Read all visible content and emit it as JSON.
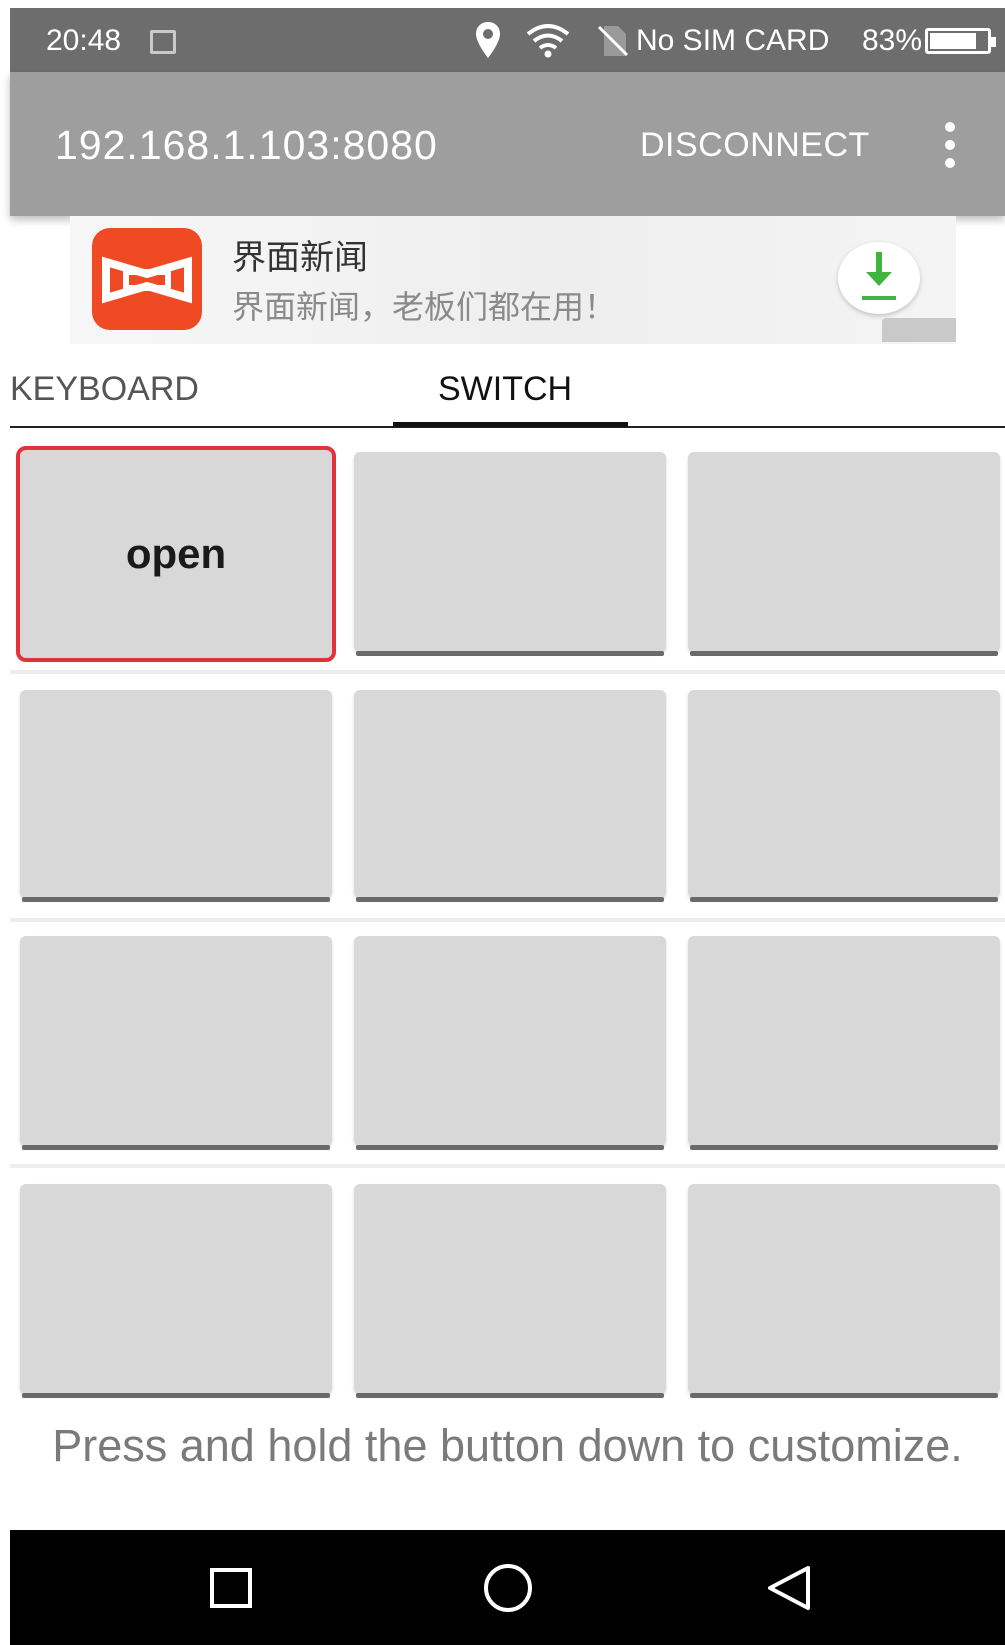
{
  "status_bar": {
    "time": "20:48",
    "carrier": "No SIM CARD",
    "battery": "83%",
    "battery_level": 0.83,
    "icons": [
      "gallery-icon",
      "location-icon",
      "wifi-icon",
      "no-sim-icon",
      "battery-icon"
    ]
  },
  "app_bar": {
    "title": "192.168.1.103:8080",
    "disconnect_label": "DISCONNECT",
    "menu_icon": "more-vert-icon"
  },
  "ad": {
    "title": "界面新闻",
    "subtitle": "界面新闻，老板们都在用！",
    "download_icon": "download-icon"
  },
  "tabs": [
    {
      "label": "KEYBOARD",
      "active": false
    },
    {
      "label": "SWITCH",
      "active": true
    }
  ],
  "grid": {
    "rows": 4,
    "cols": 3,
    "buttons": [
      "open",
      "",
      "",
      "",
      "",
      "",
      "",
      "",
      "",
      "",
      "",
      ""
    ],
    "selected_index": 0
  },
  "hint": "Press and hold the button down to customize.",
  "nav": [
    "recent-apps-icon",
    "home-icon",
    "back-icon"
  ],
  "colors": {
    "status_bar": "#6d6d6d",
    "app_bar": "#9e9e9e",
    "button": "#d8d8d8",
    "selected_outline": "#e0333c",
    "ad_logo": "#f04a25",
    "download_arrow": "#3fb53f"
  }
}
